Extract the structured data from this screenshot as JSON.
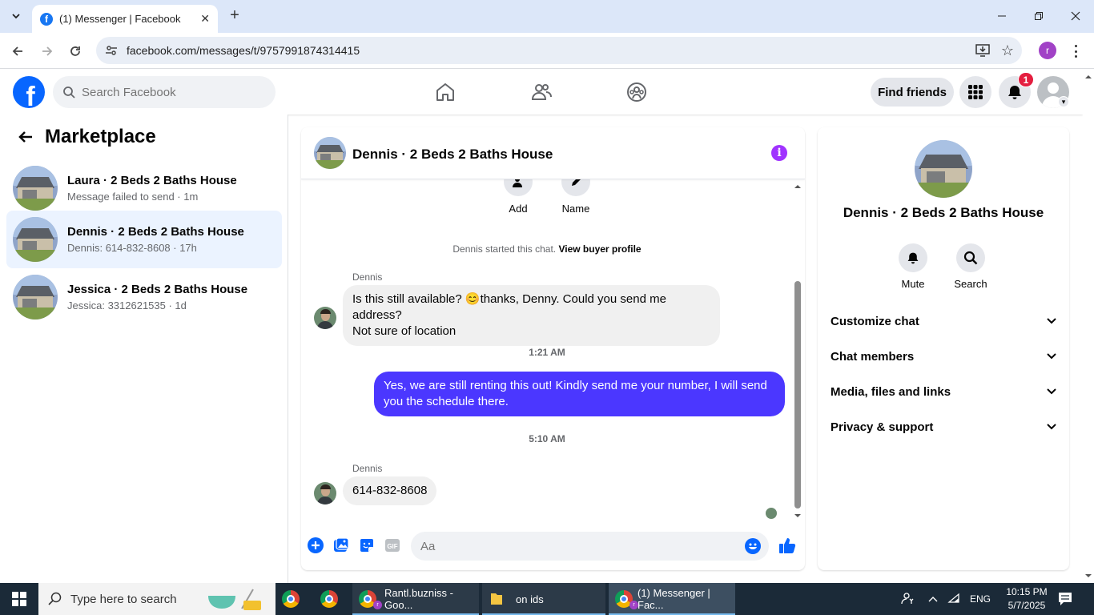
{
  "browser": {
    "tab_title": "(1) Messenger | Facebook",
    "url": "facebook.com/messages/t/9757991874314415",
    "profile_initial": "r"
  },
  "fb": {
    "search_placeholder": "Search Facebook",
    "find_friends": "Find friends",
    "notif_count": "1"
  },
  "left": {
    "title": "Marketplace",
    "conversations": [
      {
        "name": "Laura · 2 Beds 2 Baths House",
        "sub": "Message failed to send · 1m"
      },
      {
        "name": "Dennis · 2 Beds 2 Baths House",
        "sub": "Dennis: 614-832-8608 · 17h"
      },
      {
        "name": "Jessica · 2 Beds 2 Baths House",
        "sub": "Jessica: 3312621535 · 1d"
      }
    ]
  },
  "chat": {
    "name": "Dennis · 2 Beds 2 Baths House",
    "actions": [
      "Add",
      "Name"
    ],
    "started_prefix": "Dennis started this chat.",
    "view_profile": "View buyer profile",
    "messages": [
      {
        "sender": "Dennis",
        "line1": "Is this still available? 😊thanks, Denny. Could you send me address?",
        "line2": "Not sure of location"
      },
      {
        "time": "1:21 AM"
      },
      {
        "line1": "Yes, we are still renting this out! Kindly send me your number, I will send",
        "line2": "you the schedule there."
      },
      {
        "time": "5:10 AM"
      },
      {
        "sender": "Dennis",
        "line1": "614-832-8608"
      }
    ],
    "input_placeholder": "Aa"
  },
  "right": {
    "name": "Dennis · 2 Beds 2 Baths House",
    "actions": [
      "Mute",
      "Search"
    ],
    "rows": [
      "Customize chat",
      "Chat members",
      "Media, files and links",
      "Privacy & support"
    ]
  },
  "taskbar": {
    "search_placeholder": "Type here to search",
    "apps": [
      "Rantl.buzniss - Goo...",
      "on ids",
      "(1) Messenger | Fac..."
    ],
    "lang": "ENG",
    "time": "10:15 PM",
    "date": "5/7/2025"
  },
  "colors": {
    "brand_blue": "#0866ff",
    "outgoing_bubble": "#4b37ff",
    "info_purple": "#a033ff",
    "active_conv": "#ebf3ff",
    "notif_red": "#e41e3f"
  }
}
